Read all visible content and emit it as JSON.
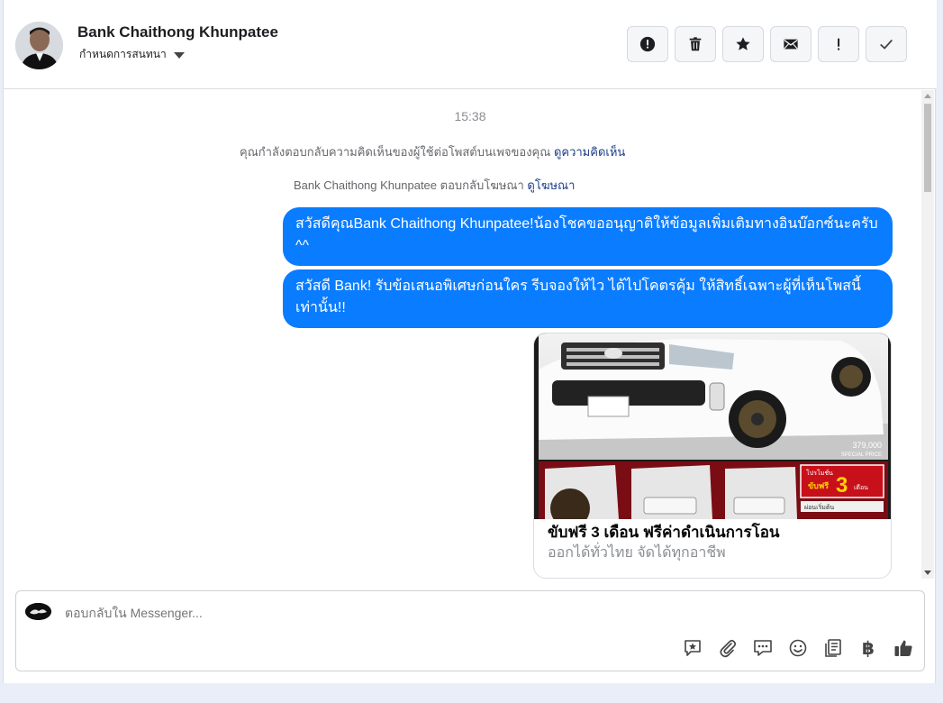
{
  "header": {
    "name": "Bank Chaithong Khunpatee",
    "assign_label": "กำหนดการสนทนา"
  },
  "actions": [
    {
      "label": "report",
      "icon": "alert-circle-icon"
    },
    {
      "label": "delete",
      "icon": "trash-icon"
    },
    {
      "label": "star",
      "icon": "star-icon"
    },
    {
      "label": "mark unread",
      "icon": "envelope-icon"
    },
    {
      "label": "important",
      "icon": "exclamation-icon"
    },
    {
      "label": "done",
      "icon": "check-icon"
    }
  ],
  "thread": {
    "time": "15:38",
    "system1_text": "คุณกำลังตอบกลับความคิดเห็นของผู้ใช้ต่อโพสต์บนเพจของคุณ",
    "system1_link": "ดูความคิดเห็น",
    "system2_text": "Bank Chaithong Khunpatee ตอบกลับโฆษณา",
    "system2_link": "ดูโฆษณา",
    "messages": [
      "สวัสดีคุณBank Chaithong Khunpatee!น้องโชคขออนุญาติให้ข้อมูลเพิ่มเติมทางอินบ๊อกซ์นะครับ ^^",
      "สวัสดี Bank! รับข้อเสนอพิเศษก่อนใคร รีบจองให้ไว ได้ไปโคตรคุ้ม ให้สิทธิ์เฉพาะผู้ที่เห็นโพสนี้เท่านั้น!!"
    ],
    "card": {
      "title": "ขับฟรี 3 เดือน ฟรีค่าดำเนินการโอน",
      "subtitle": "ออกได้ทั่วไทย จัดได้ทุกอาชีพ",
      "image_price": "379,000",
      "image_price_label": "SPECIAL PRICE",
      "image_promo_top": "โปรโมชั่น",
      "image_promo_main": "ขับฟรี",
      "image_promo_num": "3",
      "image_promo_unit": "เดือน",
      "image_small": "ผ่อนเริ่มต้น"
    }
  },
  "composer": {
    "placeholder": "ตอบกลับใน Messenger...",
    "tools": [
      "saved-reply-icon",
      "attachment-icon",
      "chat-bubbles-icon",
      "emoji-icon",
      "notes-icon",
      "baht-icon",
      "like-icon"
    ],
    "baht_symbol": "฿"
  }
}
